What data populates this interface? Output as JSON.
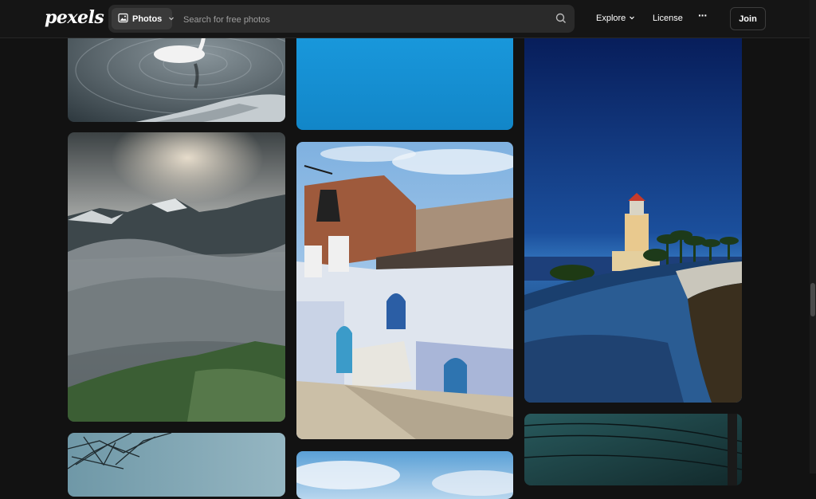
{
  "header": {
    "logo": "pexels",
    "search_type": "Photos",
    "search_placeholder": "Search for free photos",
    "nav": {
      "explore": "Explore",
      "license": "License",
      "more": "···"
    },
    "join": "Join"
  },
  "photos": [
    {
      "name": "swan-photo",
      "icon": "image",
      "colors": [
        "#47575f",
        "#a7b4ba"
      ]
    },
    {
      "name": "blue-sky-photo",
      "icon": "image",
      "colors": [
        "#1795d8",
        "#1185c4"
      ]
    },
    {
      "name": "lighthouse-photo",
      "icon": "image",
      "colors": [
        "#0a1f5b",
        "#2864ad"
      ]
    },
    {
      "name": "mountain-fog-photo",
      "icon": "image",
      "colors": [
        "#4e5558",
        "#2e5a2c"
      ]
    },
    {
      "name": "blue-village-photo",
      "icon": "image",
      "colors": [
        "#8fb7dd",
        "#c9c4ba"
      ]
    },
    {
      "name": "street-wires-photo",
      "icon": "image",
      "colors": [
        "#1f4b4e",
        "#0e1c1f"
      ]
    },
    {
      "name": "tree-branches-photo",
      "icon": "image",
      "colors": [
        "#6f98a7",
        "#2a3b40"
      ]
    },
    {
      "name": "bright-sky-photo",
      "icon": "image",
      "colors": [
        "#5aa0d6",
        "#d8e8f3"
      ]
    }
  ]
}
